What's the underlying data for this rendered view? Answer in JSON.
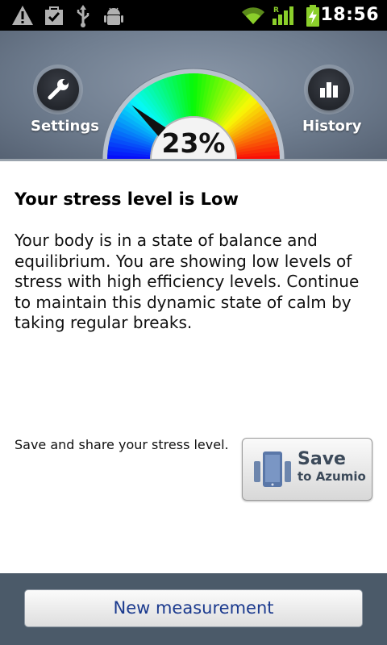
{
  "status_bar": {
    "time": "18:56",
    "icons": [
      "warning-icon",
      "bag-check-icon",
      "usb-icon",
      "android-debug-icon",
      "wifi-icon",
      "signal-icon",
      "battery-charging-icon"
    ]
  },
  "header": {
    "settings_label": "Settings",
    "history_label": "History",
    "gauge": {
      "percent_text": "23%",
      "value_percent": 23
    }
  },
  "content": {
    "title": "Your stress level is Low",
    "description": "Your body is in a state of balance and equilibrium. You are showing low levels of stress with high efficiency levels. Continue to maintain this dynamic state of calm by taking regular breaks.",
    "share_text": "Save and share your stress level.",
    "save_button": {
      "main": "Save",
      "sub": "to Azumio"
    }
  },
  "footer": {
    "new_measurement_label": "New measurement"
  }
}
